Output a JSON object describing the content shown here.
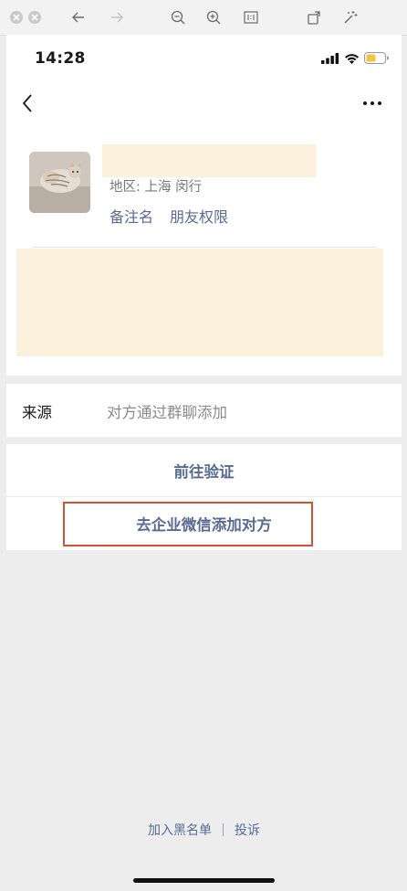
{
  "status_bar": {
    "time": "14:28"
  },
  "profile": {
    "region": "地区: 上海 闵行",
    "remark_label": "备注名",
    "friend_permission_label": "朋友权限"
  },
  "source": {
    "label": "来源",
    "value": "对方通过群聊添加"
  },
  "actions": {
    "verify_label": "前往验证",
    "wecom_add_label": "去企业微信添加对方"
  },
  "footer": {
    "blacklist_label": "加入黑名单",
    "report_label": "投诉"
  },
  "colors": {
    "link": "#576b95",
    "highlight_border": "#d3522f",
    "redacted": "#fcf1dc"
  }
}
